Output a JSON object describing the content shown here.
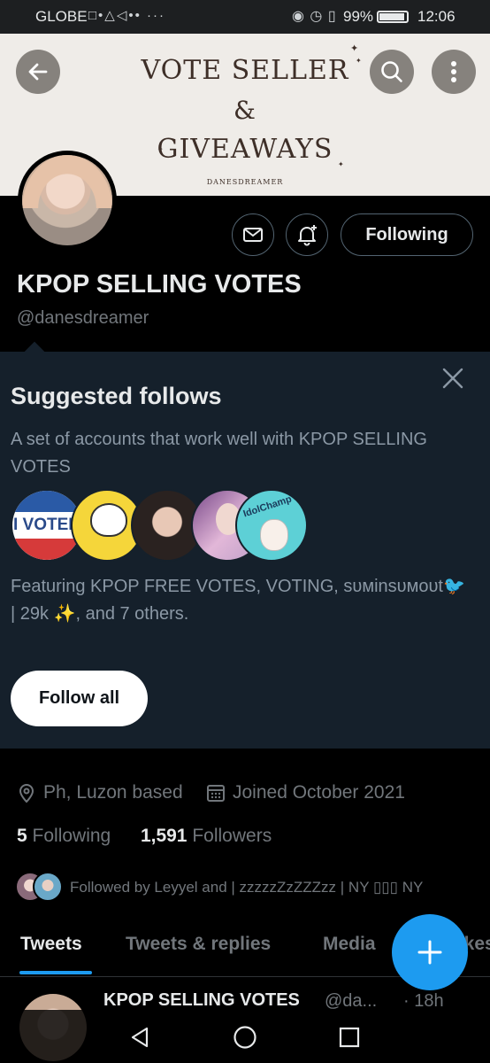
{
  "status_bar": {
    "carrier": "GLOBE",
    "left_icons": "□•△◁•• ···",
    "battery": "99%",
    "time": "12:06"
  },
  "banner": {
    "line1": "VOTE SELLER",
    "line2": "&",
    "line3": "GIVEAWAYS",
    "credit": "DANESDREAMER"
  },
  "profile": {
    "name": "KPOP SELLING VOTES",
    "handle": "@danesdreamer",
    "following_button": "Following",
    "location": "Ph, Luzon based",
    "joined": "Joined October 2021",
    "following_count": "5",
    "following_label": "Following",
    "followers_count": "1,591",
    "followers_label": "Followers",
    "followed_by": "Followed by Leyyel and | zzzzzZzZZZzz | NY ▯▯▯ NY"
  },
  "suggested": {
    "title": "Suggested follows",
    "description": "A set of accounts that work well with KPOP SELLING VOTES",
    "featuring": "Featuring KPOP FREE VOTES, VOTING, sᴜᴍinsᴜᴍoᴜt🐦 | 29k ✨, and 7 others.",
    "voted_text": "I VOTED",
    "idolchamp_text": "IdolChamp",
    "follow_all": "Follow all"
  },
  "tabs": [
    "Tweets",
    "Tweets & replies",
    "Media",
    "Likes"
  ],
  "tweet": {
    "name": "KPOP SELLING VOTES",
    "handle": "@da...",
    "time": "· 18h"
  },
  "colors": {
    "accent": "#1d9bf0",
    "panel": "#15202b",
    "banner_bg": "#efece8"
  }
}
